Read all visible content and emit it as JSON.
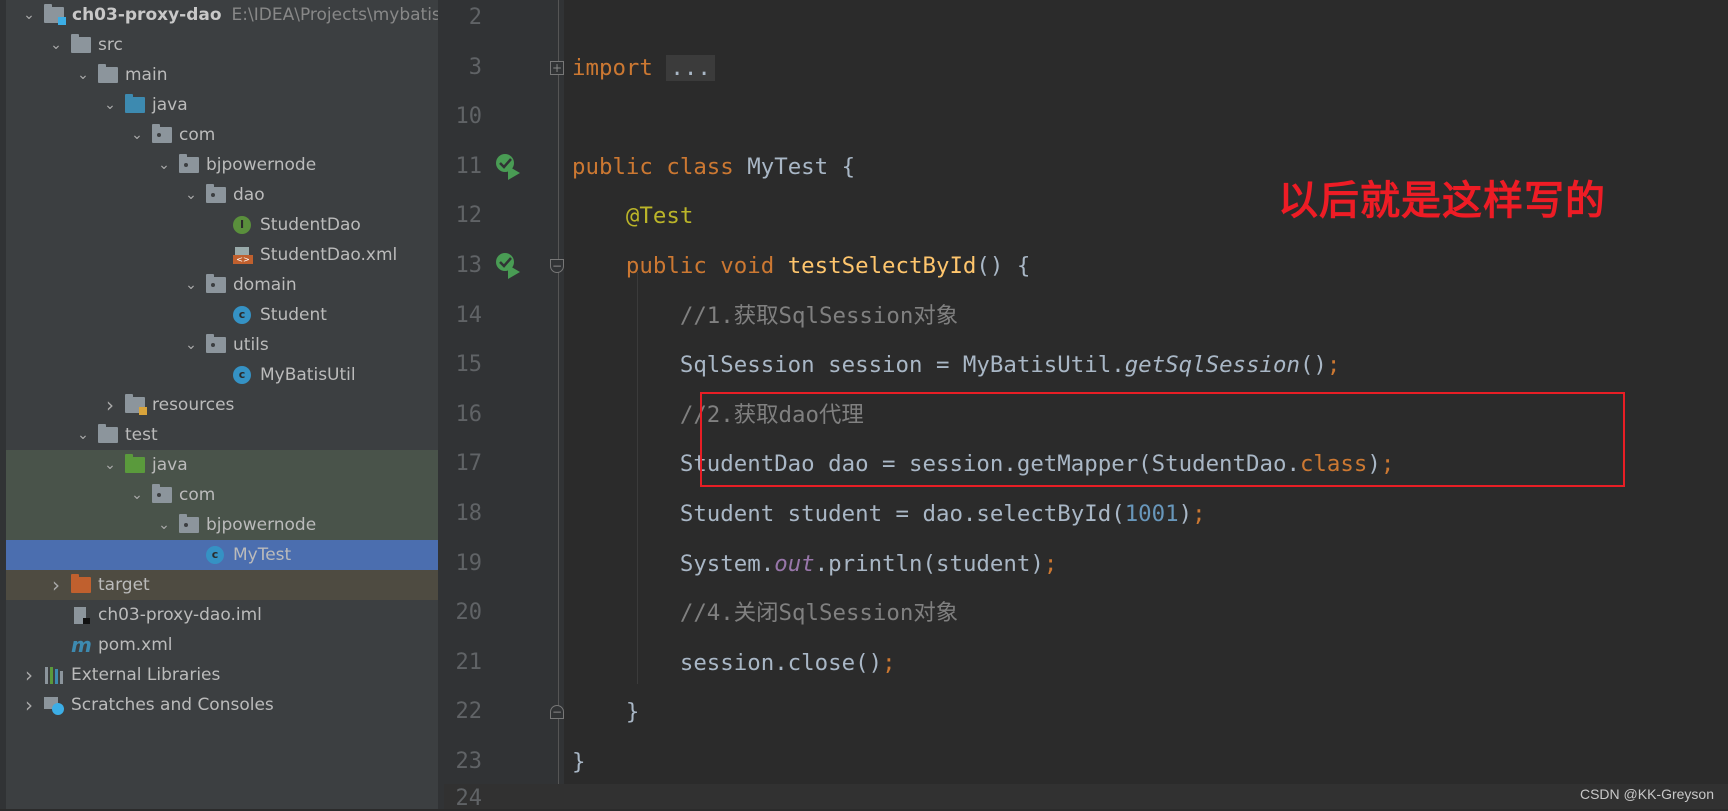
{
  "project_tree": {
    "project_name": "ch03-proxy-dao",
    "project_path": "E:\\IDEA\\Projects\\mybatis",
    "items": [
      {
        "label": "src",
        "level": 1,
        "expanded": true,
        "icon": "folder-icon"
      },
      {
        "label": "main",
        "level": 2,
        "expanded": true,
        "icon": "folder-icon"
      },
      {
        "label": "java",
        "level": 3,
        "expanded": true,
        "icon": "source-folder-icon"
      },
      {
        "label": "com",
        "level": 4,
        "expanded": true,
        "icon": "package-icon"
      },
      {
        "label": "bjpowernode",
        "level": 5,
        "expanded": true,
        "icon": "package-icon"
      },
      {
        "label": "dao",
        "level": 6,
        "expanded": true,
        "icon": "package-icon"
      },
      {
        "label": "StudentDao",
        "level": 7,
        "icon": "interface-icon"
      },
      {
        "label": "StudentDao.xml",
        "level": 7,
        "icon": "xml-file-icon"
      },
      {
        "label": "domain",
        "level": 6,
        "expanded": true,
        "icon": "package-icon"
      },
      {
        "label": "Student",
        "level": 7,
        "icon": "class-icon"
      },
      {
        "label": "utils",
        "level": 6,
        "expanded": true,
        "icon": "package-icon"
      },
      {
        "label": "MyBatisUtil",
        "level": 7,
        "icon": "class-icon"
      },
      {
        "label": "resources",
        "level": 3,
        "expanded": false,
        "icon": "resources-folder-icon"
      },
      {
        "label": "test",
        "level": 2,
        "expanded": true,
        "icon": "folder-icon"
      },
      {
        "label": "java",
        "level": 3,
        "expanded": true,
        "icon": "test-folder-icon",
        "highlight": "green"
      },
      {
        "label": "com",
        "level": 4,
        "expanded": true,
        "icon": "package-icon",
        "highlight": "green"
      },
      {
        "label": "bjpowernode",
        "level": 5,
        "expanded": true,
        "icon": "package-icon",
        "highlight": "green"
      },
      {
        "label": "MyTest",
        "level": 6,
        "icon": "test-class-icon",
        "highlight": "selected"
      },
      {
        "label": "target",
        "level": 1,
        "expanded": false,
        "icon": "excluded-folder-icon",
        "highlight": "brown"
      },
      {
        "label": "ch03-proxy-dao.iml",
        "level": 1,
        "icon": "iml-file-icon"
      },
      {
        "label": "pom.xml",
        "level": 1,
        "icon": "maven-icon"
      },
      {
        "label": "External Libraries",
        "level": 0,
        "expanded": false,
        "icon": "libraries-icon"
      },
      {
        "label": "Scratches and Consoles",
        "level": 0,
        "expanded": false,
        "icon": "scratches-icon"
      }
    ]
  },
  "colors": {
    "keyword": "#cc7832",
    "text": "#a9b7c6",
    "comment": "#808080",
    "annotation": "#bbb529",
    "method": "#ffc66d",
    "number": "#6897bb",
    "static": "#9876aa",
    "annotation_red": "#ee1c25",
    "selection": "#4b6eaf"
  },
  "editor": {
    "lines": [
      {
        "n": "2",
        "tokens": []
      },
      {
        "n": "3",
        "fold": "plus",
        "tokens": [
          {
            "t": "import ",
            "c": "keyword"
          },
          {
            "t": "...",
            "c": "ellipsis"
          }
        ]
      },
      {
        "n": "10",
        "tokens": []
      },
      {
        "n": "11",
        "run": true,
        "tokens": [
          {
            "t": "public class ",
            "c": "keyword"
          },
          {
            "t": "MyTest {",
            "c": "text"
          }
        ]
      },
      {
        "n": "12",
        "tokens": [
          {
            "t": "    "
          },
          {
            "t": "@Test",
            "c": "annotation"
          }
        ]
      },
      {
        "n": "13",
        "run": true,
        "fold": "minus",
        "tokens": [
          {
            "t": "    "
          },
          {
            "t": "public void ",
            "c": "keyword"
          },
          {
            "t": "testSelectById",
            "c": "method"
          },
          {
            "t": "() {",
            "c": "text"
          }
        ]
      },
      {
        "n": "14",
        "tokens": [
          {
            "t": "        "
          },
          {
            "t": "//1.获取SqlSession对象",
            "c": "comment"
          }
        ]
      },
      {
        "n": "15",
        "tokens": [
          {
            "t": "        SqlSession session = MyBatisUtil.",
            "c": "text"
          },
          {
            "t": "getSqlSession",
            "c": "italic"
          },
          {
            "t": "()",
            "c": "text"
          },
          {
            "t": ";",
            "c": "keyword"
          }
        ]
      },
      {
        "n": "16",
        "tokens": [
          {
            "t": "        "
          },
          {
            "t": "//2.获取dao代理",
            "c": "comment"
          }
        ]
      },
      {
        "n": "17",
        "tokens": [
          {
            "t": "        StudentDao dao = session.getMapper(StudentDao.",
            "c": "text"
          },
          {
            "t": "class",
            "c": "keyword"
          },
          {
            "t": ")",
            "c": "text"
          },
          {
            "t": ";",
            "c": "keyword"
          }
        ]
      },
      {
        "n": "18",
        "tokens": [
          {
            "t": "        Student student = dao.selectById(",
            "c": "text"
          },
          {
            "t": "1001",
            "c": "number"
          },
          {
            "t": ")",
            "c": "text"
          },
          {
            "t": ";",
            "c": "keyword"
          }
        ]
      },
      {
        "n": "19",
        "tokens": [
          {
            "t": "        System.",
            "c": "text"
          },
          {
            "t": "out",
            "c": "static"
          },
          {
            "t": ".println(student)",
            "c": "text"
          },
          {
            "t": ";",
            "c": "keyword"
          }
        ]
      },
      {
        "n": "20",
        "tokens": [
          {
            "t": "        "
          },
          {
            "t": "//4.关闭SqlSession对象",
            "c": "comment"
          }
        ]
      },
      {
        "n": "21",
        "tokens": [
          {
            "t": "        session.close()",
            "c": "text"
          },
          {
            "t": ";",
            "c": "keyword"
          }
        ]
      },
      {
        "n": "22",
        "fold": "end",
        "tokens": [
          {
            "t": "    }",
            "c": "text"
          }
        ]
      },
      {
        "n": "23",
        "tokens": [
          {
            "t": "}",
            "c": "text"
          }
        ]
      }
    ],
    "partial_line_number": "24"
  },
  "annotation_note": "以后就是这样写的",
  "watermark": "CSDN @KK-Greyson"
}
